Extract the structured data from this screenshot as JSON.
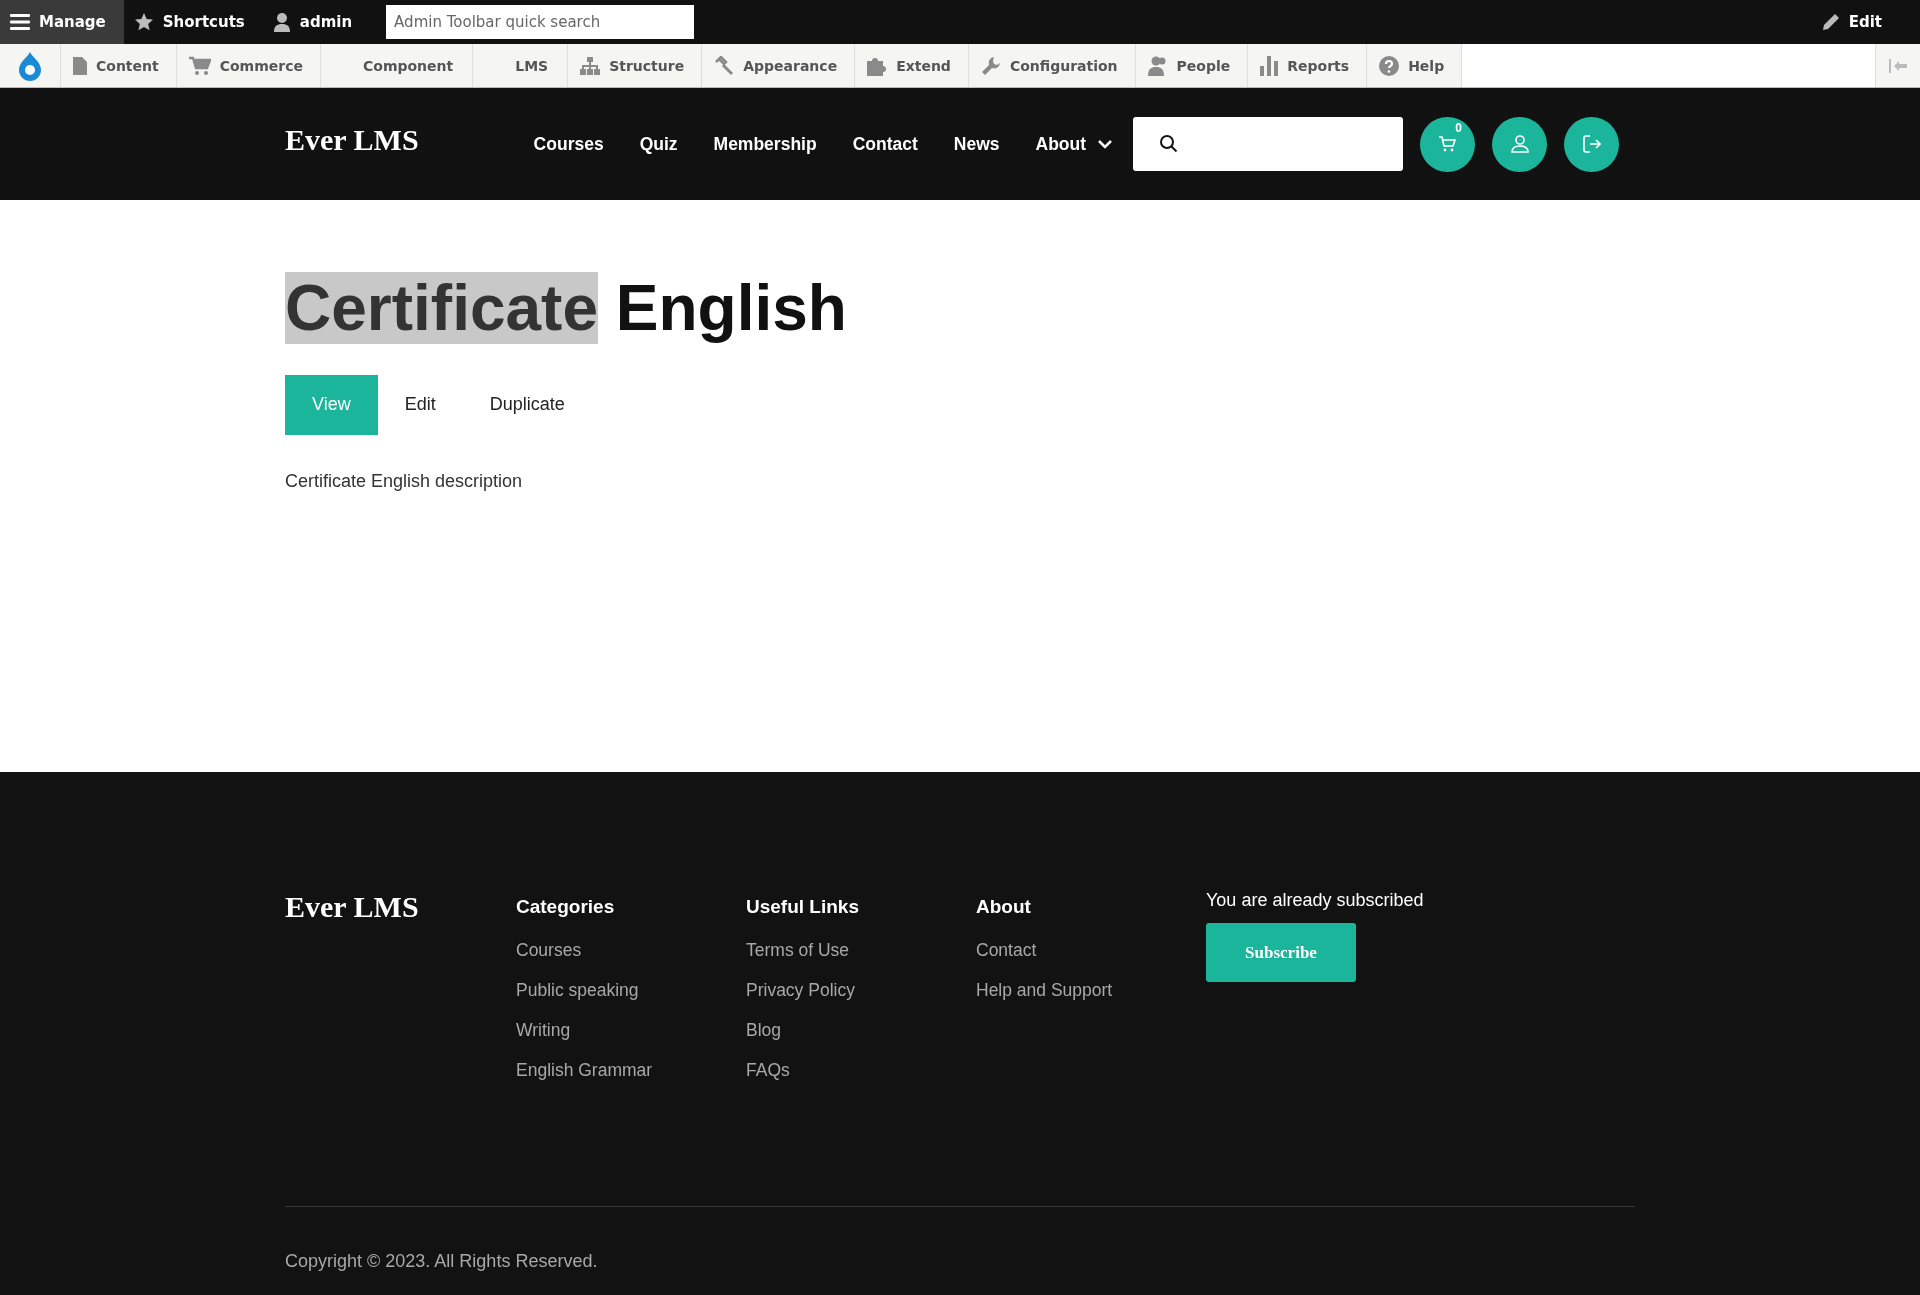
{
  "admin_bar": {
    "items": [
      {
        "label": "Manage",
        "selected": true
      },
      {
        "label": "Shortcuts",
        "selected": false
      },
      {
        "label": "admin",
        "selected": false
      }
    ],
    "search": {
      "placeholder": "Admin Toolbar quick search"
    },
    "edit": {
      "label": "Edit"
    }
  },
  "tray": {
    "items": [
      {
        "label": "Content"
      },
      {
        "label": "Commerce"
      },
      {
        "label": "Component"
      },
      {
        "label": "LMS"
      },
      {
        "label": "Structure"
      },
      {
        "label": "Appearance"
      },
      {
        "label": "Extend"
      },
      {
        "label": "Configuration"
      },
      {
        "label": "People"
      },
      {
        "label": "Reports"
      },
      {
        "label": "Help"
      }
    ]
  },
  "header": {
    "logo": "Ever LMS",
    "nav": [
      {
        "label": "Courses",
        "has_dropdown": false
      },
      {
        "label": "Quiz",
        "has_dropdown": false
      },
      {
        "label": "Membership",
        "has_dropdown": false
      },
      {
        "label": "Contact",
        "has_dropdown": false
      },
      {
        "label": "News",
        "has_dropdown": false
      },
      {
        "label": "About",
        "has_dropdown": true
      }
    ],
    "cart_count": "0"
  },
  "page": {
    "title_parts": [
      {
        "text": "Certificate",
        "selected": true
      },
      {
        "text": "English",
        "selected": false
      }
    ],
    "tabs": [
      {
        "label": "View",
        "selected": true
      },
      {
        "label": "Edit",
        "selected": false
      },
      {
        "label": "Duplicate",
        "selected": false
      }
    ],
    "description": "Certificate English description"
  },
  "footer": {
    "logo": "Ever LMS",
    "columns": [
      {
        "heading": "Categories",
        "links": [
          "Courses",
          "Public speaking",
          "Writing",
          "English Grammar"
        ]
      },
      {
        "heading": "Useful Links",
        "links": [
          "Terms of Use",
          "Privacy Policy",
          "Blog",
          "FAQs"
        ]
      },
      {
        "heading": "About",
        "links": [
          "Contact",
          "Help and Support"
        ]
      }
    ],
    "subscribe_note": "You are already subscribed",
    "subscribe_button": "Subscribe",
    "copyright": "Copyright © 2023. All Rights Reserved."
  }
}
